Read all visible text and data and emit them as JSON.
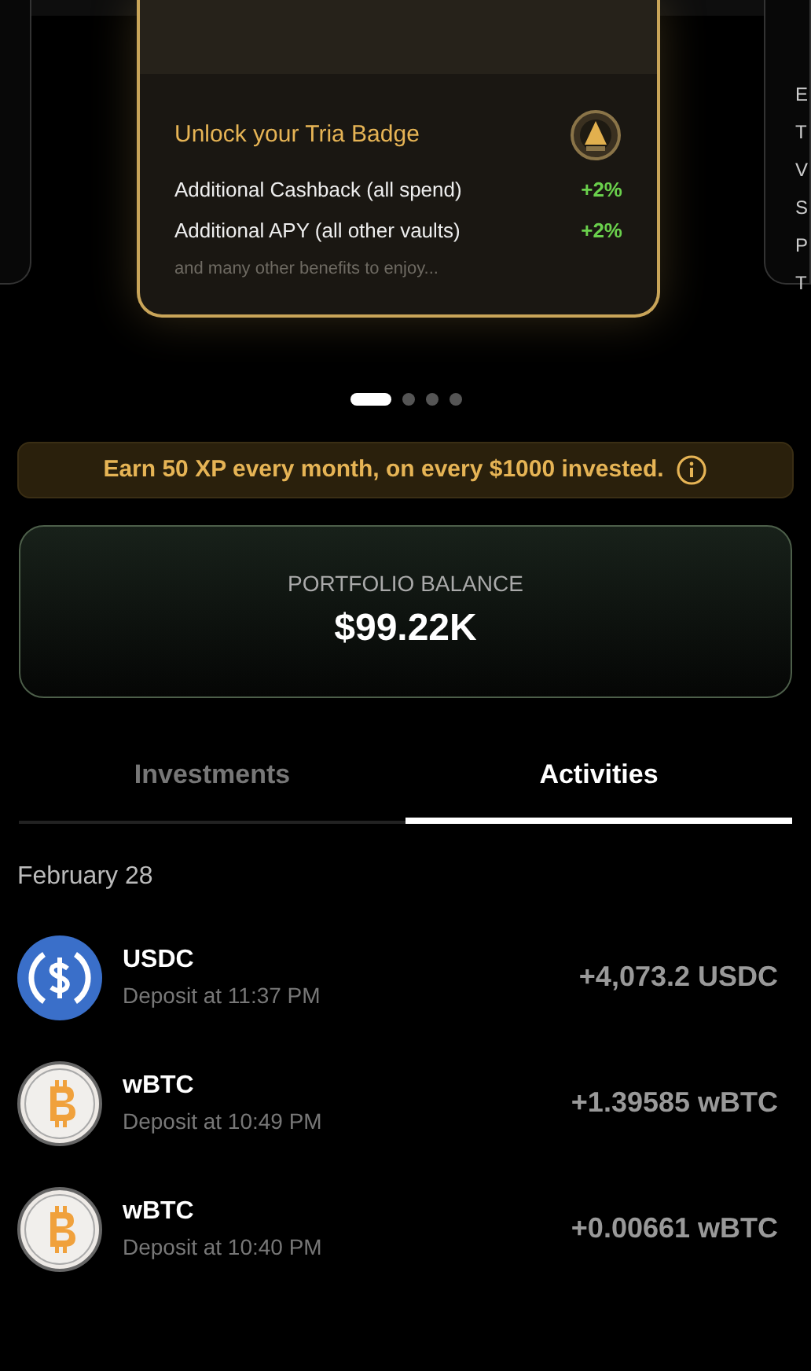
{
  "carousel": {
    "right_peek_letters": [
      "E",
      "T",
      "V",
      "S",
      "P",
      "T"
    ],
    "card": {
      "title": "Unlock your Tria Badge",
      "benefits": [
        {
          "label": "Additional Cashback (all spend)",
          "value": "+2%"
        },
        {
          "label": "Additional APY (all other vaults)",
          "value": "+2%"
        }
      ],
      "footnote": "and many other benefits to enjoy..."
    },
    "dots": [
      {
        "selected": true
      },
      {
        "selected": false
      },
      {
        "selected": false
      },
      {
        "selected": false
      }
    ]
  },
  "banner": {
    "text": "Earn 50 XP every month, on every $1000 invested."
  },
  "balance": {
    "label": "PORTFOLIO BALANCE",
    "value": "$99.22K"
  },
  "tabs": [
    {
      "label": "Investments",
      "selected": false
    },
    {
      "label": "Activities",
      "selected": true
    }
  ],
  "activity": {
    "date": "February 28",
    "items": [
      {
        "kind": "usdc",
        "asset": "USDC",
        "detail": "Deposit at 11:37 PM",
        "amount": "+4,073.2 USDC"
      },
      {
        "kind": "btc",
        "asset": "wBTC",
        "detail": "Deposit at 10:49 PM",
        "amount": "+1.39585 wBTC"
      },
      {
        "kind": "btc",
        "asset": "wBTC",
        "detail": "Deposit at 10:40 PM",
        "amount": "+0.00661 wBTC"
      }
    ]
  }
}
